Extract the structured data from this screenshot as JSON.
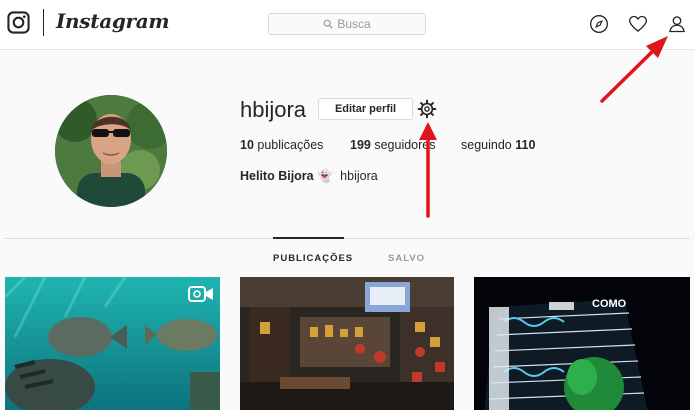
{
  "header": {
    "logo_icon": "instagram-camera-icon",
    "wordmark": "Instagram",
    "search": {
      "placeholder": "Busca",
      "icon": "search-icon"
    },
    "nav_icons": [
      "compass-icon",
      "heart-icon",
      "person-icon"
    ]
  },
  "profile": {
    "username": "hbijora",
    "edit_button": "Editar perfil",
    "settings_icon": "gear-icon",
    "stats": {
      "posts_count": "10",
      "posts_label": "publicações",
      "followers_count": "199",
      "followers_label": "seguidores",
      "following_label": "seguindo",
      "following_count": "110"
    },
    "full_name": "Helito Bijora",
    "name_emoji": "👻",
    "handle": "hbijora"
  },
  "tabs": [
    {
      "label": "PUBLICAÇÕES",
      "active": true
    },
    {
      "label": "SALVO",
      "active": false
    }
  ],
  "posts": [
    {
      "kind": "video",
      "badge_icon": "video-camera-icon",
      "subject": "aquarium fish"
    },
    {
      "kind": "photo",
      "subject": "bar interior"
    },
    {
      "kind": "photo",
      "subject": "night building",
      "sign": "COMO"
    }
  ],
  "annotations": {
    "arrow_color": "#e0141b"
  },
  "colors": {
    "border": "#dbdbdb",
    "text": "#262626",
    "muted": "#999999",
    "background": "#fafafa"
  }
}
